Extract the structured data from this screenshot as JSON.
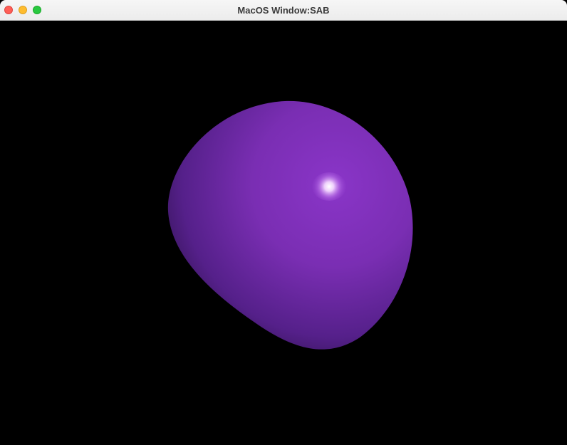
{
  "window": {
    "title": "MacOS Window:SAB",
    "buttons": {
      "close": "close-button",
      "minimize": "minimize-button",
      "zoom": "zoom-button"
    }
  },
  "scene": {
    "background_color": "#000000",
    "object": "shaded-sphere",
    "object_color": "#8a35c8",
    "highlight_color": "#ffffff"
  }
}
